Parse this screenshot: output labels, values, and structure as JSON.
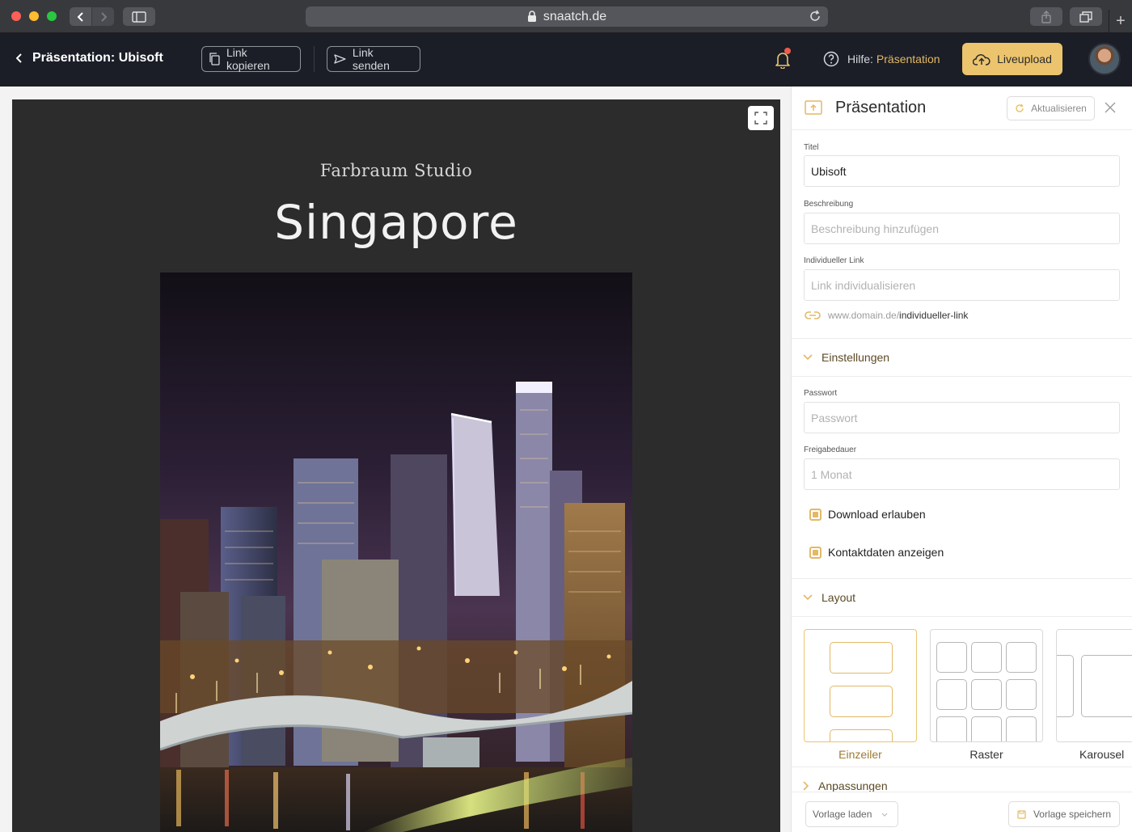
{
  "browser": {
    "url": "snaatch.de"
  },
  "header": {
    "title": "Präsentation: Ubisoft",
    "copy_link": "Link kopieren",
    "send_link": "Link senden",
    "help_prefix": "Hilfe:",
    "help_topic": "Präsentation",
    "liveupload": "Liveupload"
  },
  "preview": {
    "studio": "Farbraum Studio",
    "title": "Singapore"
  },
  "panel": {
    "title": "Präsentation",
    "refresh": "Aktualisieren",
    "fields": {
      "titel_label": "Titel",
      "titel_value": "Ubisoft",
      "beschreibung_label": "Beschreibung",
      "beschreibung_placeholder": "Beschreibung hinzufügen",
      "link_label": "Individueller Link",
      "link_placeholder": "Link individualisieren",
      "link_domain": "www.domain.de/",
      "link_slug": "individueller-link"
    },
    "settings": {
      "heading": "Einstellungen",
      "passwort_label": "Passwort",
      "passwort_placeholder": "Passwort",
      "freigabe_label": "Freigabedauer",
      "freigabe_value": "1 Monat",
      "download": "Download erlauben",
      "kontakt": "Kontaktdaten anzeigen"
    },
    "layout": {
      "heading": "Layout",
      "options": [
        "Einzeiler",
        "Raster",
        "Karousel"
      ],
      "selected": "Einzeiler"
    },
    "anpassungen": "Anpassungen",
    "footer": {
      "load": "Vorlage laden",
      "save": "Vorlage speichern"
    }
  },
  "colors": {
    "accent": "#ECC46E",
    "appbar": "#1B1E27",
    "canvas": "#2C2C2C"
  }
}
